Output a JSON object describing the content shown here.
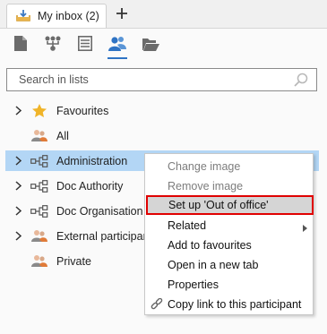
{
  "tabs": [
    {
      "label": "My inbox (2)",
      "icon": "inbox-icon"
    }
  ],
  "new_tab_icon": "plus-icon",
  "toolbar": {
    "buttons": [
      {
        "name": "document-icon"
      },
      {
        "name": "org-chart-icon"
      },
      {
        "name": "list-icon"
      },
      {
        "name": "participants-icon",
        "active": true
      },
      {
        "name": "open-folder-icon"
      }
    ]
  },
  "search": {
    "placeholder": "Search in lists",
    "value": ""
  },
  "tree": {
    "items": [
      {
        "label": "Favourites",
        "icon": "star-icon",
        "expandable": true
      },
      {
        "label": "All",
        "icon": "users-icon",
        "expandable": false
      },
      {
        "label": "Administration",
        "icon": "org-unit-icon",
        "expandable": true,
        "selected": true
      },
      {
        "label": "Doc Authority",
        "icon": "org-unit-icon",
        "expandable": true
      },
      {
        "label": "Doc Organisation",
        "icon": "org-unit-icon",
        "expandable": true
      },
      {
        "label": "External participant",
        "icon": "users-icon",
        "expandable": true
      },
      {
        "label": "Private",
        "icon": "users-icon",
        "expandable": false
      }
    ]
  },
  "context_menu": {
    "items": [
      {
        "label": "Change image",
        "disabled": true
      },
      {
        "label": "Remove image",
        "disabled": true
      },
      {
        "label": "Set up 'Out of office'",
        "highlighted": true
      },
      {
        "label": "Related",
        "submenu": true
      },
      {
        "label": "Add to favourites"
      },
      {
        "label": "Open in a new tab"
      },
      {
        "label": "Properties"
      },
      {
        "label": "Copy link to this participant",
        "icon": "link-icon"
      }
    ]
  },
  "colors": {
    "accent": "#2e73c4",
    "selection": "#b3d6f5",
    "highlight_border": "#e00000",
    "star": "#f0b429"
  }
}
